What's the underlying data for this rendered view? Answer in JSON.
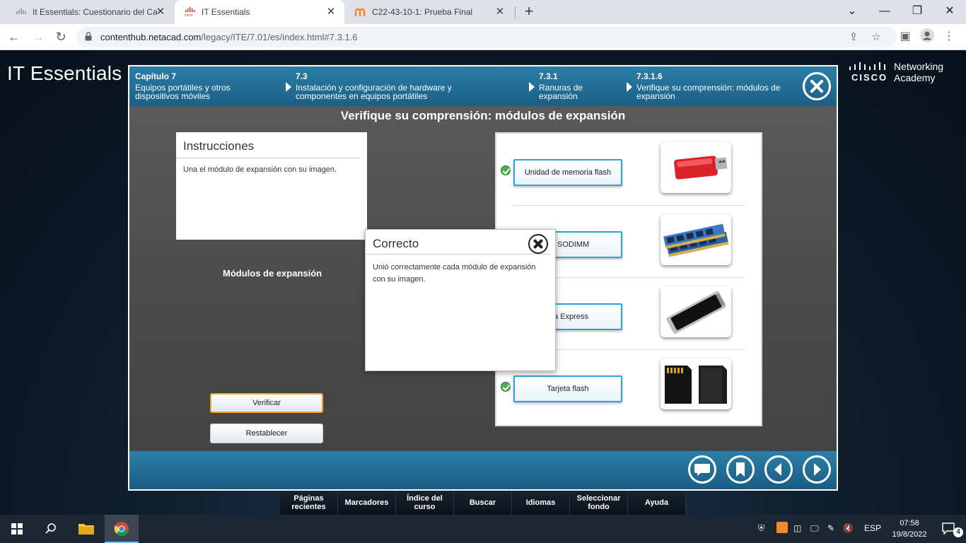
{
  "browser": {
    "tabs": [
      {
        "title": "It Essentials: Cuestionario del Cap",
        "active": false,
        "icon": "netacad-icon"
      },
      {
        "title": "IT Essentials",
        "active": true,
        "icon": "cisco-icon"
      },
      {
        "title": "C22-43-10-1: Prueba Final",
        "active": false,
        "icon": "moodle-icon"
      }
    ],
    "url_host": "contenthub.netacad.com",
    "url_path": "/legacy/ITE/7.01/es/index.html#7.3.1.6"
  },
  "site": {
    "title": "IT Essentials",
    "logo_word": "CISCO",
    "logo_line1": "Networking",
    "logo_line2": "Academy"
  },
  "breadcrumbs": [
    {
      "num": "Capítulo 7",
      "text": "Equipos portátiles y otros dispositivos móviles"
    },
    {
      "num": "7.3",
      "text": "Instalación y configuración de hardware y componentes en equipos portátiles"
    },
    {
      "num": "7.3.1",
      "text": "Ranuras de expansión"
    },
    {
      "num": "7.3.1.6",
      "text": "Verifique su comprensión: módulos de expansión"
    }
  ],
  "activity": {
    "title": "Verifique su comprensión: módulos de expansión",
    "instructions_title": "Instrucciones",
    "instructions_text": "Una el módulo de expansión con su imagen.",
    "modules_label": "Módulos de expansión",
    "verify_label": "Verificar",
    "reset_label": "Restablecer",
    "matches": [
      {
        "label": "Unidad de memoria flash",
        "checked": true,
        "image": "usb-flash-drive"
      },
      {
        "label": "ria SODIMM",
        "checked": false,
        "image": "sodimm-memory"
      },
      {
        "label": "eta Express",
        "checked": false,
        "image": "expresscard"
      },
      {
        "label": "Tarjeta flash",
        "checked": true,
        "image": "sd-cards"
      }
    ],
    "popup": {
      "title": "Correcto",
      "text": "Unió correctamente cada módulo de expansión con su imagen."
    }
  },
  "bottom_nav": [
    "Páginas recientes",
    "Marcadores",
    "Índice del curso",
    "Buscar",
    "Idiomas",
    "Seleccionar fondo",
    "Ayuda"
  ],
  "taskbar": {
    "lang": "ESP",
    "time": "07:58",
    "date": "19/8/2022",
    "notifications": "4"
  }
}
